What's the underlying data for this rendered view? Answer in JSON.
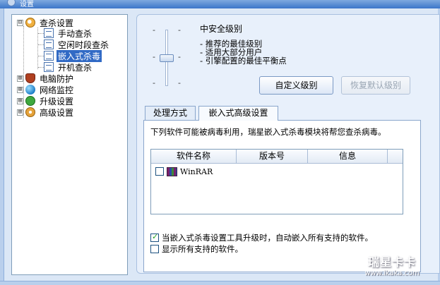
{
  "window": {
    "title": "设置"
  },
  "tree": {
    "nodes": [
      {
        "label": "查杀设置",
        "expander": "⊟",
        "icon": "search-icon"
      },
      {
        "label": "手动查杀",
        "icon": "page-icon"
      },
      {
        "label": "空闲时段查杀",
        "icon": "page-icon"
      },
      {
        "label": "嵌入式杀毒",
        "icon": "page-icon",
        "selected": true
      },
      {
        "label": "开机查杀",
        "icon": "page-icon"
      },
      {
        "label": "电脑防护",
        "expander": "⊞",
        "icon": "shield-icon"
      },
      {
        "label": "网络监控",
        "expander": "⊞",
        "icon": "globe-icon"
      },
      {
        "label": "升级设置",
        "expander": "⊞",
        "icon": "upgrade-icon"
      },
      {
        "label": "高级设置",
        "expander": "⊞",
        "icon": "gear-icon"
      }
    ]
  },
  "security_level": {
    "title": "中安全级别",
    "lines": [
      "- 推荐的最佳级别",
      "- 适用大部分用户",
      "- 引擎配置的最佳平衡点"
    ],
    "tick": "-",
    "slider_level": 0.5,
    "custom_button": "自定义级别",
    "restore_button": "恢复默认级别"
  },
  "tabs": [
    {
      "label": "处理方式"
    },
    {
      "label": "嵌入式高级设置"
    }
  ],
  "embedded": {
    "intro": "下列软件可能被病毒利用，瑞星嵌入式杀毒模块将帮您查杀病毒。",
    "columns": [
      "软件名称",
      "版本号",
      "信息"
    ],
    "rows": [
      {
        "name": "WinRAR",
        "version": "",
        "info": "",
        "checked": false
      }
    ],
    "option_auto_embed": "当嵌入式杀毒设置工具升级时，自动嵌入所有支持的软件。",
    "option_auto_embed_checked": true,
    "option_show_all": "显示所有支持的软件。",
    "option_show_all_checked": false
  },
  "watermark": {
    "brand": "瑞星卡卡",
    "url": "www.ikaka.com"
  }
}
